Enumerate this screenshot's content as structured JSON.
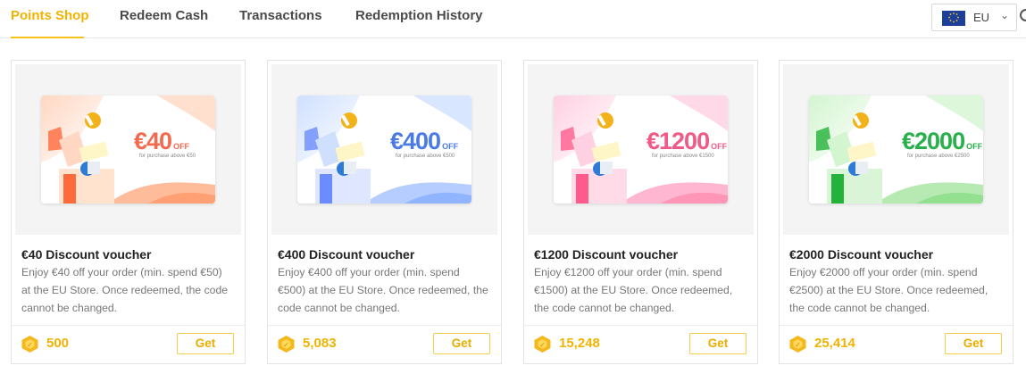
{
  "tabs": [
    {
      "label": "Points Shop",
      "active": true
    },
    {
      "label": "Redeem Cash",
      "active": false
    },
    {
      "label": "Transactions",
      "active": false
    },
    {
      "label": "Redemption History",
      "active": false
    }
  ],
  "region": {
    "label": "EU",
    "flag_icon": "eu-flag-icon"
  },
  "colors": {
    "accent": "#f0b400",
    "button_border": "#f5cd4c"
  },
  "cards": [
    {
      "amount": "€40",
      "off": "OFF",
      "sub": "for purchase above €50",
      "amount_color": "#f26a4f",
      "theme": "orange",
      "title": "€40 Discount voucher",
      "description": "Enjoy €40 off your order (min. spend €50) at the EU Store. Once redeemed, the code cannot be changed.",
      "points": "500",
      "button": "Get"
    },
    {
      "amount": "€400",
      "off": "OFF",
      "sub": "for purchase above €500",
      "amount_color": "#4b7be5",
      "theme": "blue",
      "title": "€400 Discount voucher",
      "description": "Enjoy €400 off your order (min. spend €500) at the EU Store. Once redeemed, the code cannot be changed.",
      "points": "5,083",
      "button": "Get"
    },
    {
      "amount": "€1200",
      "off": "OFF",
      "sub": "for purchase above €1500",
      "amount_color": "#ef5a86",
      "theme": "pink",
      "title": "€1200 Discount voucher",
      "description": "Enjoy €1200 off your order (min. spend €1500) at the EU Store. Once redeemed, the code cannot be changed.",
      "points": "15,248",
      "button": "Get"
    },
    {
      "amount": "€2000",
      "off": "OFF",
      "sub": "for purchase above €2500",
      "amount_color": "#28b04a",
      "theme": "green",
      "title": "€2000 Discount voucher",
      "description": "Enjoy €2000 off your order (min. spend €2500) at the EU Store. Once redeemed, the code cannot be changed.",
      "points": "25,414",
      "button": "Get"
    }
  ]
}
